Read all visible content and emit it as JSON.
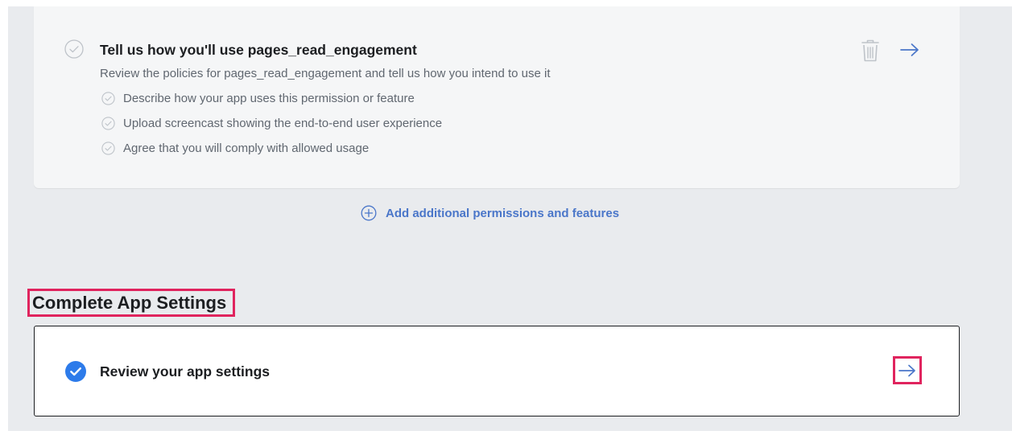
{
  "permission": {
    "title": "Tell us how you'll use pages_read_engagement",
    "description": "Review the policies for pages_read_engagement and tell us how you intend to use it",
    "steps": [
      {
        "label": "Describe how your app uses this permission or feature"
      },
      {
        "label": "Upload screencast showing the end-to-end user experience"
      },
      {
        "label": "Agree that you will comply with allowed usage"
      }
    ]
  },
  "add_link": {
    "label": "Add additional permissions and features"
  },
  "app_settings": {
    "section_title": "Complete App Settings",
    "item_label": "Review your app settings"
  },
  "icons": {
    "permission_status": "check-circle-outline-icon",
    "step_status": "check-circle-outline-icon",
    "delete": "trash-icon",
    "navigate": "arrow-right-icon",
    "add": "plus-circle-icon",
    "completed": "check-circle-filled-icon"
  },
  "colors": {
    "accent": "#4a76c9",
    "completed": "#2d7bea",
    "highlight": "#e0245e",
    "muted_icon": "#bec3c9",
    "page_bg": "#e9ebee",
    "card_bg": "#f5f6f7"
  }
}
